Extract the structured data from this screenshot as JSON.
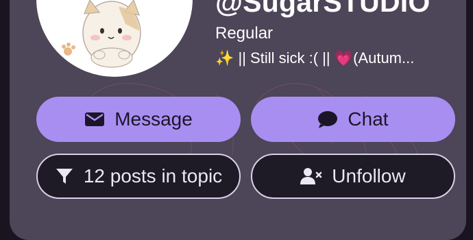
{
  "profile": {
    "username": "@SugarSTUDIO",
    "title": "Regular",
    "status": "✨ || Still sick :( || 💗(Autum..."
  },
  "actions": {
    "message_label": "Message",
    "chat_label": "Chat",
    "posts_label": "12 posts in topic",
    "unfollow_label": "Unfollow"
  },
  "colors": {
    "card_background": "#4d4558",
    "primary_button": "#a98ef2",
    "outline_button": "#1e1a26",
    "page_background": "#1a1420"
  },
  "icons": {
    "message": "envelope-icon",
    "chat": "chat-bubble-icon",
    "posts": "filter-icon",
    "unfollow": "user-x-icon"
  }
}
